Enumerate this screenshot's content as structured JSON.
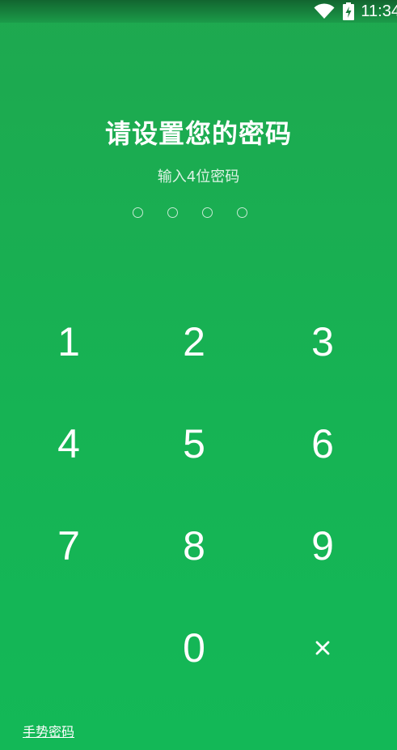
{
  "status_bar": {
    "time": "11:34",
    "icons": [
      "wifi-icon",
      "battery-charging-icon"
    ]
  },
  "title": "请设置您的密码",
  "subtitle": "输入4位密码",
  "pin_length": 4,
  "keypad": {
    "keys": [
      "1",
      "2",
      "3",
      "4",
      "5",
      "6",
      "7",
      "8",
      "9",
      "0"
    ],
    "delete_icon": "close-icon"
  },
  "gesture_link": "手势密码",
  "colors": {
    "background": "#16b354",
    "text": "#ffffff"
  }
}
